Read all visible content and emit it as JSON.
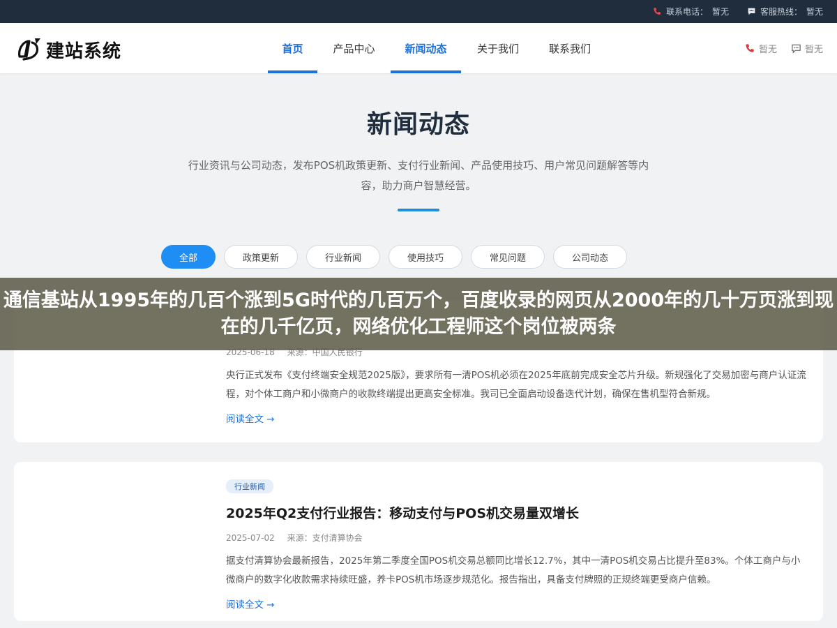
{
  "topbar": {
    "phone_label": "联系电话：",
    "phone_value": "暂无",
    "hotline_label": "客服热线：",
    "hotline_value": "暂无"
  },
  "header": {
    "logo_text": "建站系统",
    "phone_value": "暂无",
    "chat_value": "暂无"
  },
  "nav": {
    "items": [
      {
        "label": "首页"
      },
      {
        "label": "产品中心"
      },
      {
        "label": "新闻动态"
      },
      {
        "label": "关于我们"
      },
      {
        "label": "联系我们"
      }
    ]
  },
  "hero": {
    "title": "新闻动态",
    "description": "行业资讯与公司动态，发布POS机政策更新、支付行业新闻、产品使用技巧、用户常见问题解答等内容，助力商户智慧经营。"
  },
  "filters": [
    "全部",
    "政策更新",
    "行业新闻",
    "使用技巧",
    "常见问题",
    "公司动态"
  ],
  "banner": {
    "text": "通信基站从1995年的几百个涨到5G时代的几百万个，百度收录的网页从2000年的几十万页涨到现在的几千亿页，网络优化工程师这个岗位被两条"
  },
  "articles": [
    {
      "date": "2025-06-18",
      "source": "来源：中国人民银行",
      "excerpt": "央行正式发布《支付终端安全规范2025版》，要求所有一清POS机必须在2025年底前完成安全芯片升级。新规强化了交易加密与商户认证流程，对个体工商户和小微商户的收款终端提出更高安全标准。我司已全面启动设备迭代计划，确保在售机型符合新规。",
      "more": "阅读全文 →"
    },
    {
      "tag": "行业新闻",
      "title": "2025年Q2支付行业报告：移动支付与POS机交易量双增长",
      "date": "2025-07-02",
      "source": "来源：支付清算协会",
      "excerpt": "据支付清算协会最新报告，2025年第二季度全国POS机交易总额同比增长12.7%，其中一清POS机交易占比提升至83%。个体工商户与小微商户的数字化收款需求持续旺盛，养卡POS机市场逐步规范化。报告指出，具备支付牌照的正规终端更受商户信赖。",
      "more": "阅读全文 →"
    }
  ],
  "colors": {
    "accent": "#1e6fd9",
    "topbar_bg": "#1f2d3d",
    "chip_active": "#1e8ef5"
  }
}
